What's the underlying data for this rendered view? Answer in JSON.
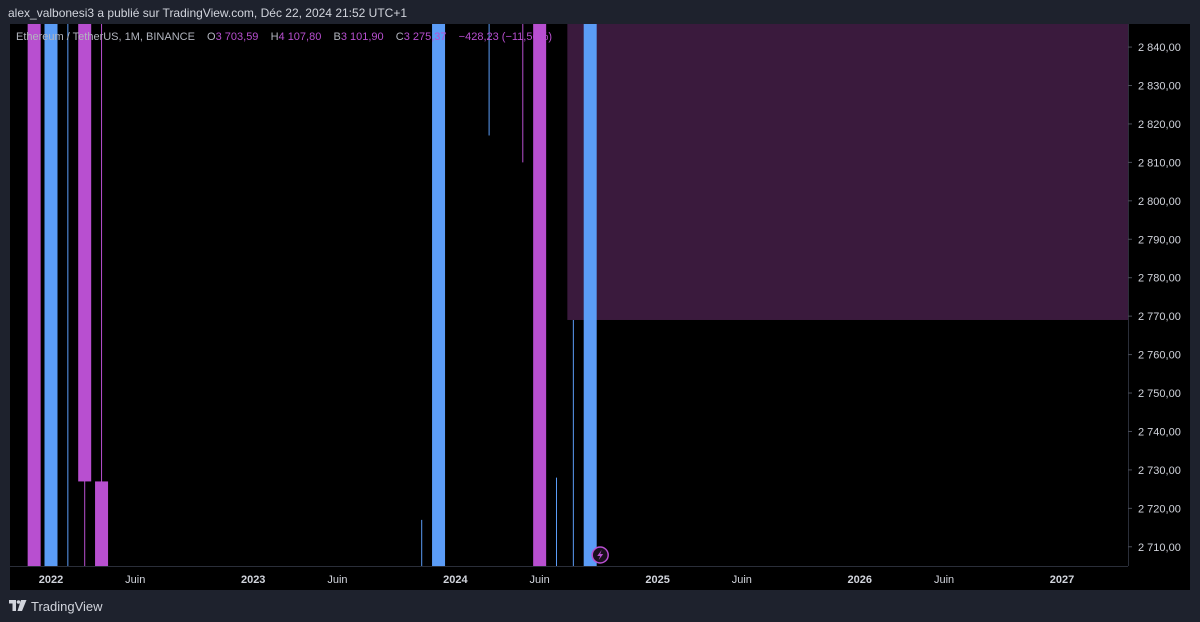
{
  "header": {
    "publish_line": "alex_valbonesi3 a publié sur TradingView.com, Déc 22, 2024 21:52 UTC+1"
  },
  "legend": {
    "symbol": "Ethereum / TetherUS, 1M, BINANCE",
    "o_label": "O",
    "o_value": "3 703,59",
    "h_label": "H",
    "h_value": "4 107,80",
    "b_label": "B",
    "b_value": "3 101,90",
    "c_label": "C",
    "c_value": "3 275,37",
    "change": "−428,23 (−11,56%)"
  },
  "footer": {
    "brand": "TradingView"
  },
  "colors": {
    "up": "#5b9cf6",
    "down": "#b84fd0",
    "zone": "#3a1a3d",
    "background": "#000000",
    "frame": "#1e222d"
  },
  "chart_data": {
    "type": "candlestick",
    "y_range": [
      2705,
      2846
    ],
    "y_ticks": [
      "2 840,00",
      "2 830,00",
      "2 820,00",
      "2 810,00",
      "2 800,00",
      "2 790,00",
      "2 780,00",
      "2 770,00",
      "2 760,00",
      "2 750,00",
      "2 740,00",
      "2 730,00",
      "2 720,00",
      "2 710,00"
    ],
    "x_ticks": [
      {
        "label": "2022",
        "date": "2022-01",
        "bold": true
      },
      {
        "label": "Juin",
        "date": "2022-06",
        "bold": false
      },
      {
        "label": "2023",
        "date": "2023-01",
        "bold": true
      },
      {
        "label": "Juin",
        "date": "2023-06",
        "bold": false
      },
      {
        "label": "2024",
        "date": "2024-01",
        "bold": true
      },
      {
        "label": "Juin",
        "date": "2024-06",
        "bold": false
      },
      {
        "label": "2025",
        "date": "2025-01",
        "bold": true
      },
      {
        "label": "Juin",
        "date": "2025-06",
        "bold": false
      },
      {
        "label": "2026",
        "date": "2026-01",
        "bold": true
      },
      {
        "label": "Juin",
        "date": "2026-06",
        "bold": false
      },
      {
        "label": "2027",
        "date": "2027-01",
        "bold": true
      }
    ],
    "candles": [
      {
        "date": "2021-12",
        "dir": "down",
        "body_low": 2705,
        "body_high": 2846
      },
      {
        "date": "2022-01",
        "dir": "up",
        "body_low": 2705,
        "body_high": 2846
      },
      {
        "date": "2022-02",
        "dir": "up",
        "wick_low": 2705,
        "wick_high": 2846
      },
      {
        "date": "2022-03",
        "dir": "down",
        "body_low": 2727,
        "body_high": 2846,
        "wick_low": 2705
      },
      {
        "date": "2022-04",
        "dir": "down",
        "body_low": 2705,
        "body_high": 2727,
        "wick_high": 2846
      },
      {
        "date": "2023-11",
        "dir": "up",
        "wick_low": 2705,
        "wick_high": 2717
      },
      {
        "date": "2023-12",
        "dir": "up",
        "body_low": 2705,
        "body_high": 2846
      },
      {
        "date": "2024-03",
        "dir": "up",
        "wick_low": 2817,
        "wick_high": 2846
      },
      {
        "date": "2024-05",
        "dir": "down",
        "wick_low": 2810,
        "wick_high": 2846
      },
      {
        "date": "2024-06",
        "dir": "down",
        "body_low": 2705,
        "body_high": 2846
      },
      {
        "date": "2024-07",
        "dir": "up",
        "wick_low": 2705,
        "wick_high": 2728
      },
      {
        "date": "2024-08",
        "dir": "up",
        "wick_low": 2705,
        "wick_high": 2769
      },
      {
        "date": "2024-09",
        "dir": "up",
        "body_low": 2705,
        "body_high": 2846
      }
    ],
    "zone": {
      "from": "2024-08",
      "to": "2027-10",
      "low": 2769,
      "high": 2846
    }
  }
}
